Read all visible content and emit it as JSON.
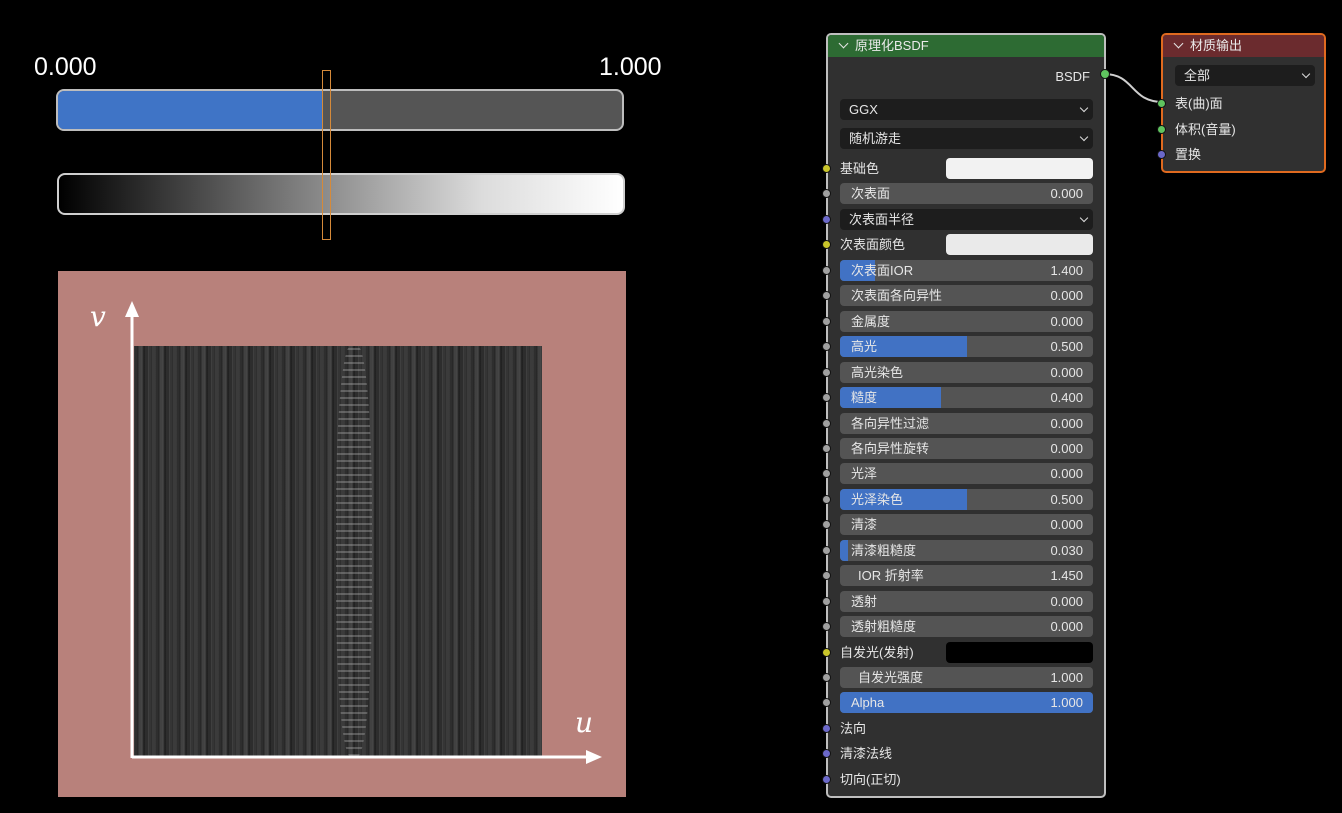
{
  "diagram": {
    "min_label": "0.000",
    "max_label": "1.000",
    "bar_value": 0.47,
    "v_label": "v",
    "u_label": "u"
  },
  "bsdf_node": {
    "title": "原理化BSDF",
    "output_label": "BSDF",
    "distribution": "GGX",
    "subsurface_method": "随机游走",
    "rows": [
      {
        "type": "color",
        "label": "基础色",
        "color": "#f2f2f2",
        "socket": "#c9c52a"
      },
      {
        "type": "value",
        "label": "次表面",
        "value": "0.000",
        "fill": 0,
        "socket": "#a0a0a0"
      },
      {
        "type": "dropdown",
        "label": "次表面半径",
        "socket": "#6b68c9"
      },
      {
        "type": "color",
        "label": "次表面颜色",
        "color": "#eaeaea",
        "socket": "#c9c52a"
      },
      {
        "type": "value",
        "label": "次表面IOR",
        "value": "1.400",
        "fill": 0.14,
        "socket": "#a0a0a0"
      },
      {
        "type": "value",
        "label": "次表面各向异性",
        "value": "0.000",
        "fill": 0,
        "socket": "#a0a0a0"
      },
      {
        "type": "value",
        "label": "金属度",
        "value": "0.000",
        "fill": 0,
        "socket": "#a0a0a0"
      },
      {
        "type": "value",
        "label": "高光",
        "value": "0.500",
        "fill": 0.5,
        "socket": "#a0a0a0"
      },
      {
        "type": "value",
        "label": "高光染色",
        "value": "0.000",
        "fill": 0,
        "socket": "#a0a0a0"
      },
      {
        "type": "value",
        "label": "糙度",
        "value": "0.400",
        "fill": 0.4,
        "socket": "#a0a0a0"
      },
      {
        "type": "value",
        "label": "各向异性过滤",
        "value": "0.000",
        "fill": 0,
        "socket": "#a0a0a0"
      },
      {
        "type": "value",
        "label": "各向异性旋转",
        "value": "0.000",
        "fill": 0,
        "socket": "#a0a0a0"
      },
      {
        "type": "value",
        "label": "光泽",
        "value": "0.000",
        "fill": 0,
        "socket": "#a0a0a0"
      },
      {
        "type": "value",
        "label": "光泽染色",
        "value": "0.500",
        "fill": 0.5,
        "socket": "#a0a0a0"
      },
      {
        "type": "value",
        "label": "清漆",
        "value": "0.000",
        "fill": 0,
        "socket": "#a0a0a0"
      },
      {
        "type": "value",
        "label": "清漆粗糙度",
        "value": "0.030",
        "fill": 0.03,
        "socket": "#a0a0a0"
      },
      {
        "type": "value",
        "label": "IOR 折射率",
        "value": "1.450",
        "fill": 0,
        "socket": "#a0a0a0",
        "center": true
      },
      {
        "type": "value",
        "label": "透射",
        "value": "0.000",
        "fill": 0,
        "socket": "#a0a0a0"
      },
      {
        "type": "value",
        "label": "透射粗糙度",
        "value": "0.000",
        "fill": 0,
        "socket": "#a0a0a0"
      },
      {
        "type": "color",
        "label": "自发光(发射)",
        "color": "#000000",
        "socket": "#c9c52a"
      },
      {
        "type": "value",
        "label": "自发光强度",
        "value": "1.000",
        "fill": 0,
        "socket": "#a0a0a0",
        "center": true
      },
      {
        "type": "value",
        "label": "Alpha",
        "value": "1.000",
        "fill": 1,
        "socket": "#a0a0a0"
      },
      {
        "type": "input",
        "label": "法向",
        "socket": "#6b68c9"
      },
      {
        "type": "input",
        "label": "清漆法线",
        "socket": "#6b68c9"
      },
      {
        "type": "input",
        "label": "切向(正切)",
        "socket": "#6b68c9"
      }
    ]
  },
  "output_node": {
    "title": "材质输出",
    "target": "全部",
    "inputs": [
      {
        "label": "表(曲)面",
        "socket": "#5fc45f"
      },
      {
        "label": "体积(音量)",
        "socket": "#5fc45f"
      },
      {
        "label": "置换",
        "socket": "#6b68c9"
      }
    ]
  },
  "colors": {
    "bsdf_header": "#2d6b33",
    "output_header": "#6b2b2e",
    "output_border": "#e06a1f",
    "accent_blue": "#4172c4"
  }
}
